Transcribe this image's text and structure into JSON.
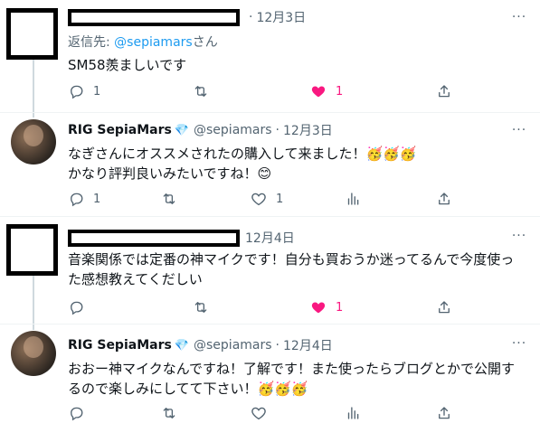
{
  "tweets": [
    {
      "author_redacted": true,
      "date": "12月3日",
      "reply_prefix": "返信先: ",
      "reply_mention": "@sepiamars",
      "reply_suffix": "さん",
      "text_lines": [
        "SM58羨ましいです"
      ],
      "replies": "1",
      "retweets": "",
      "likes": "1",
      "liked": true
    },
    {
      "name": "RIG SepiaMars",
      "verified_emoji": "💎",
      "handle": "@sepiamars",
      "date": "12月3日",
      "text_lines": [
        "なぎさんにオススメされたの購入して来ました！🥳🥳🥳",
        "かなり評判良いみたいですね！😊"
      ],
      "replies": "1",
      "retweets": "",
      "likes": "1",
      "liked": false
    },
    {
      "author_redacted": true,
      "date": "12月4日",
      "text_lines": [
        "音楽関係では定番の神マイクです！自分も買おうか迷ってるんで今度使っ",
        "た感想教えてくだしい"
      ],
      "replies": "",
      "retweets": "",
      "likes": "1",
      "liked": true
    },
    {
      "name": "RIG SepiaMars",
      "verified_emoji": "💎",
      "handle": "@sepiamars",
      "date": "12月4日",
      "text_lines": [
        "おおー神マイクなんですね！了解です！また使ったらブログとかで公開す",
        "るので楽しみにしてて下さい！🥳🥳🥳"
      ],
      "replies": "",
      "retweets": "",
      "likes": "",
      "liked": false
    }
  ],
  "more_label": "···",
  "colors": {
    "accent": "#1d9bf0",
    "like": "#f91880",
    "muted": "#536471"
  },
  "icons": [
    "reply-icon",
    "retweet-icon",
    "like-icon",
    "share-icon",
    "analytics-icon",
    "more-icon",
    "verified-diamond-icon"
  ]
}
